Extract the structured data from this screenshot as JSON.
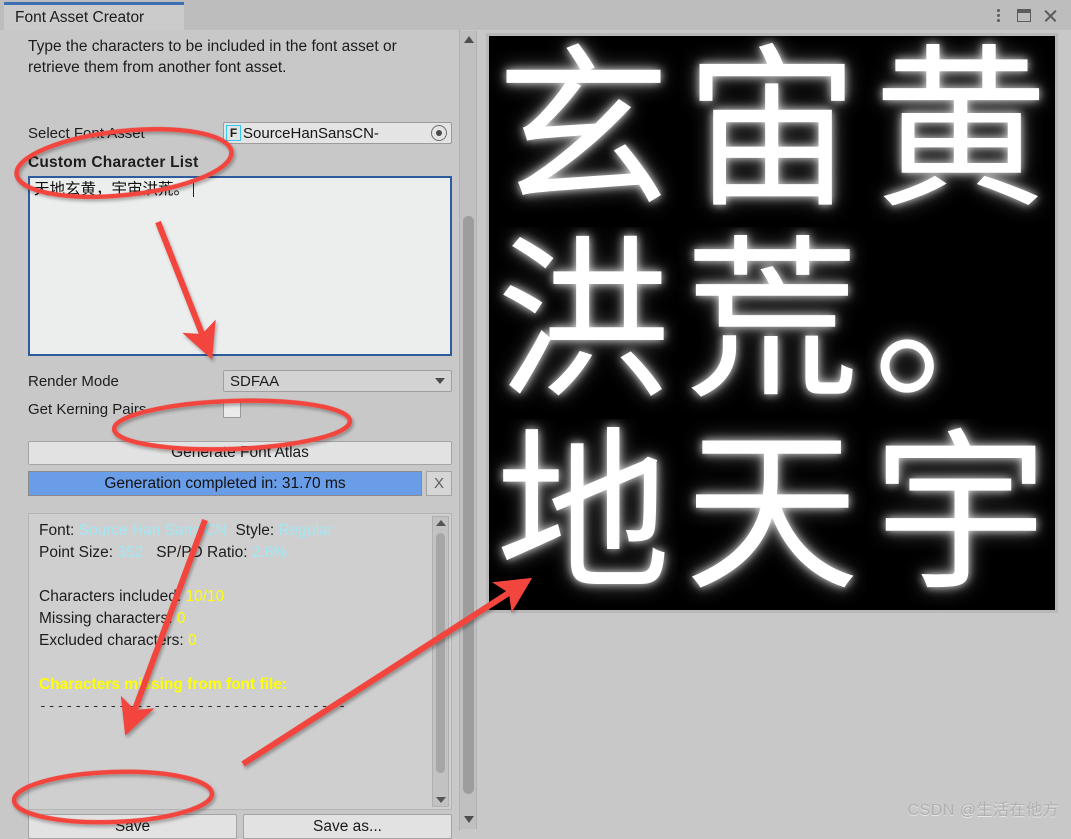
{
  "window": {
    "tab_title": "Font Asset Creator",
    "controls": {
      "menu": "menu-dots-icon",
      "maximize": "maximize-icon",
      "close": "close-icon"
    }
  },
  "panel": {
    "help_text": "Type the characters to be included in the font asset or retrieve them from another font asset.",
    "select_font_asset": {
      "label": "Select Font Asset",
      "value": "SourceHanSansCN-",
      "icon": "font-asset-icon",
      "picker": "object-picker-icon"
    },
    "custom_character_list": {
      "label": "Custom Character List",
      "value": "天地玄黄，宇宙洪荒。"
    },
    "render_mode": {
      "label": "Render Mode",
      "value": "SDFAA"
    },
    "get_kerning_pairs": {
      "label": "Get Kerning Pairs",
      "checked": false
    },
    "generate_button": "Generate Font Atlas",
    "progress": {
      "text": "Generation completed in: 31.70 ms",
      "cancel_label": "X",
      "fill_color": "#6a9de8"
    },
    "info": {
      "font_label": "Font:",
      "font_value": "Source Han Sans CN",
      "style_label": "Style:",
      "style_value": "Regular",
      "point_size_label": "Point Size:",
      "point_size_value": "352",
      "ratio_label": "SP/PD Ratio:",
      "ratio_value": "2.6%",
      "characters_included_label": "Characters included:",
      "characters_included_value": "10/10",
      "missing_characters_label": "Missing characters:",
      "missing_characters_value": "0",
      "excluded_characters_label": "Excluded characters:",
      "excluded_characters_value": "0",
      "missing_from_font_file": "Characters missing from font file:",
      "separator": "-----------------------------------"
    },
    "save_button": "Save",
    "save_as_button": "Save as..."
  },
  "atlas": {
    "glyphs": [
      "玄",
      "宙",
      "黄",
      "洪",
      "荒",
      "。",
      "地",
      "天",
      "宇"
    ],
    "background": "#000000",
    "glyph_color": "#ffffff"
  },
  "annotations": {
    "accent_color": "#f2443c",
    "ellipses": [
      "custom-character-list-highlight",
      "generate-font-atlas-highlight",
      "save-button-highlight"
    ],
    "arrows": [
      "arrow-to-render-mode",
      "arrow-to-save-button",
      "arrow-to-atlas-preview"
    ]
  },
  "watermark": "CSDN @生活在他方"
}
